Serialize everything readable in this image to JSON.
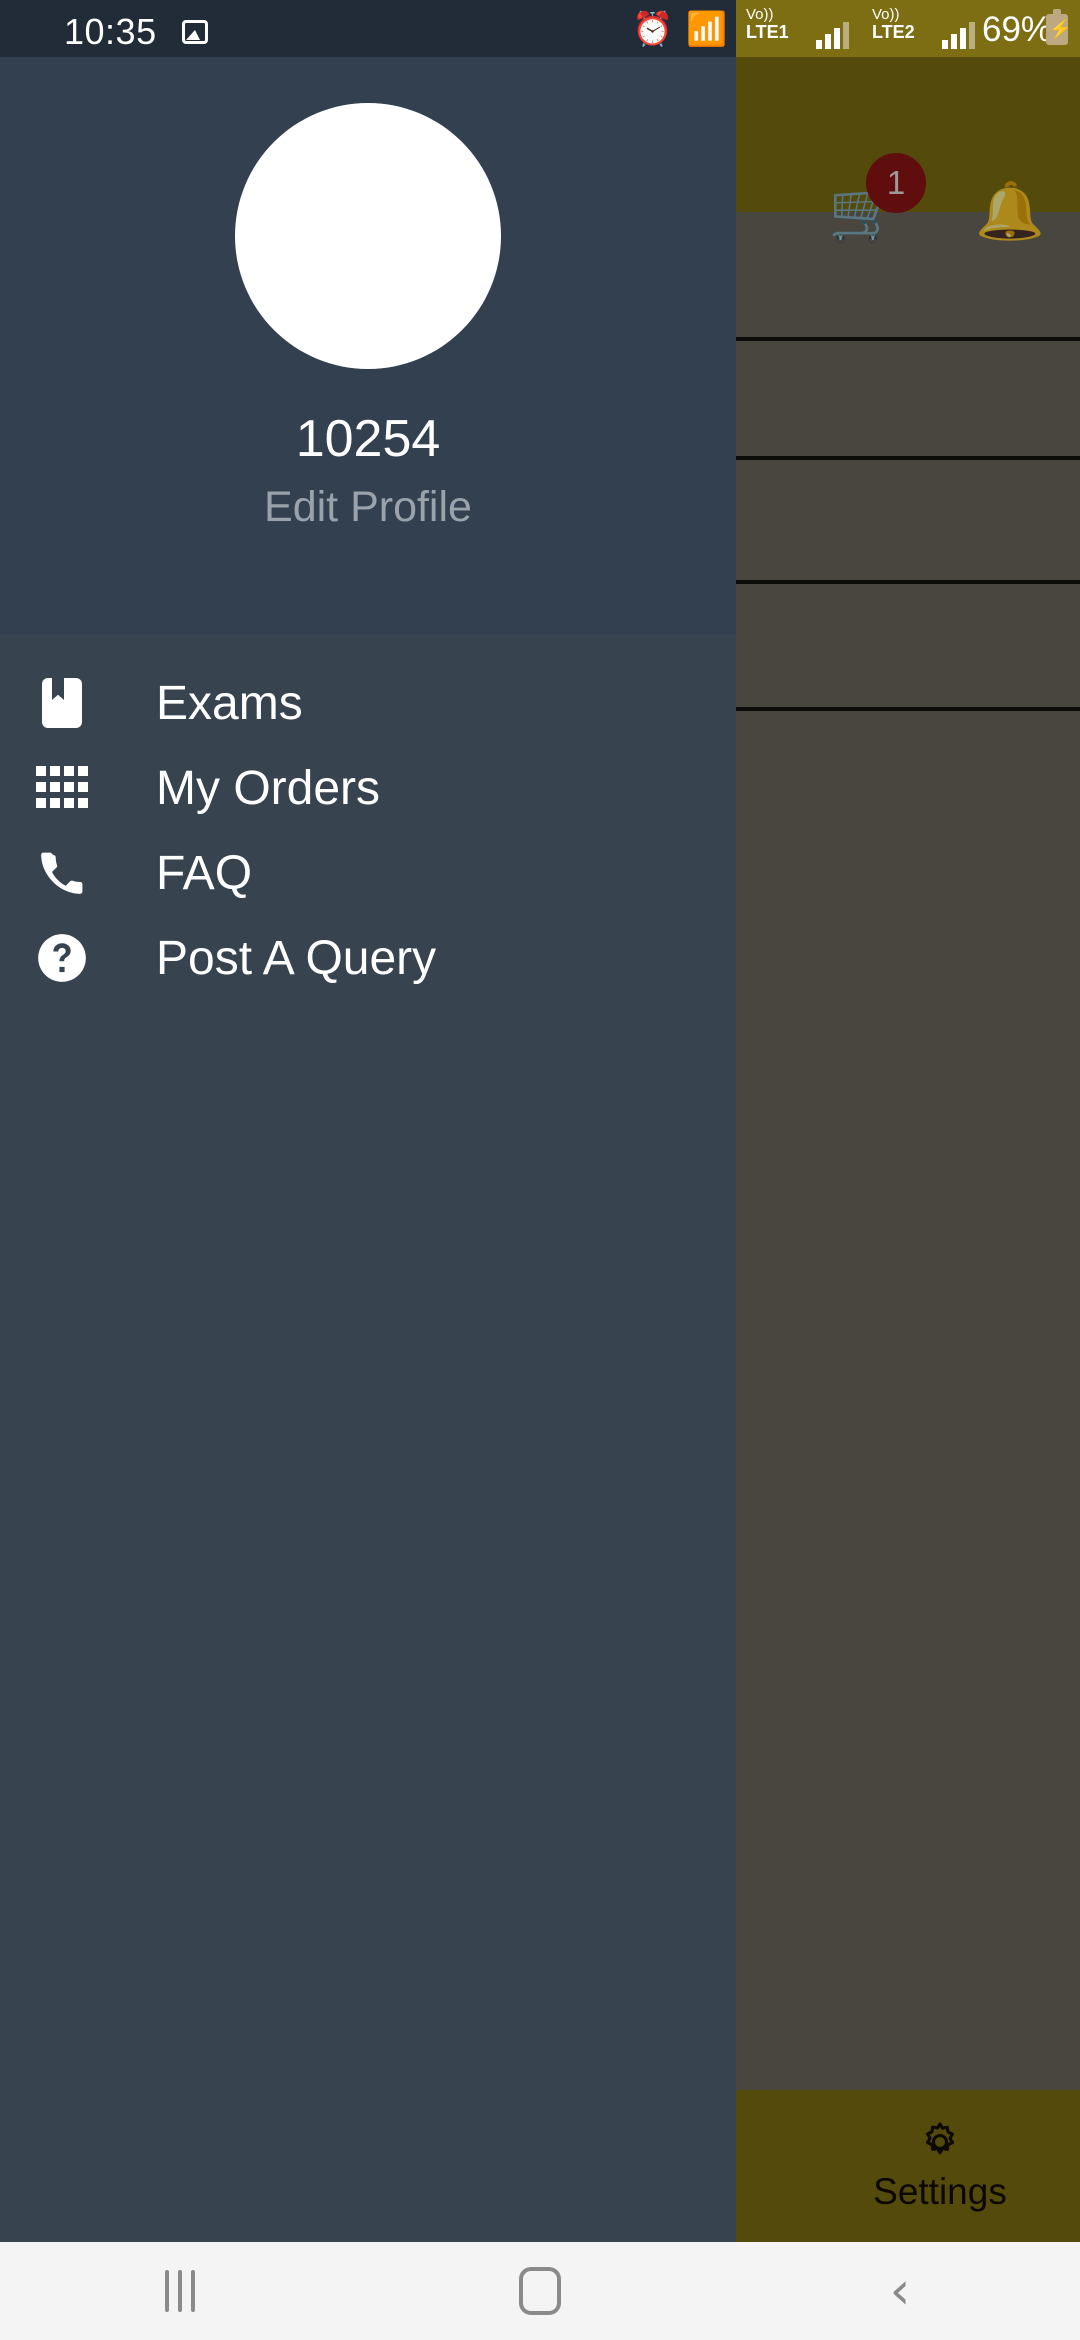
{
  "status_bar": {
    "time": "10:35",
    "photo_icon": "image-icon",
    "alarm_icon": "alarm-clock-icon",
    "wifi_icon": "wifi-data-transfer-icon",
    "sim1": {
      "volte": "Vo))",
      "network": "LTE1"
    },
    "sim2": {
      "volte": "Vo))",
      "network": "LTE2"
    },
    "battery_percent": "69%",
    "battery_icon": "battery-charging-icon"
  },
  "app_toolbar": {
    "cart_icon": "shopping-cart-icon",
    "cart_badge_count": "1",
    "notification_icon": "bell-ringing-icon"
  },
  "drawer": {
    "profile": {
      "avatar": "user-avatar",
      "name": "10254",
      "edit_label": "Edit Profile"
    },
    "items": [
      {
        "label": "Exams",
        "icon": "book-bookmark-icon"
      },
      {
        "label": "My Orders",
        "icon": "grid-apps-icon"
      },
      {
        "label": "FAQ",
        "icon": "phone-icon"
      },
      {
        "label": "Post A Query",
        "icon": "help-circle-icon"
      }
    ]
  },
  "bottom_tabs": {
    "settings": {
      "label": "Settings",
      "icon": "gear-icon"
    }
  },
  "system_nav": {
    "recents": "recents-icon",
    "home": "home-icon",
    "back": "back-icon",
    "back_glyph": "‹"
  },
  "colors": {
    "drawer_header": "#33404f",
    "drawer_menu": "#37434f",
    "toolbar": "#7d6d13",
    "badge": "#8c1414",
    "status_bar_left": "#222c38",
    "nav_bar": "#f4f4f4"
  }
}
